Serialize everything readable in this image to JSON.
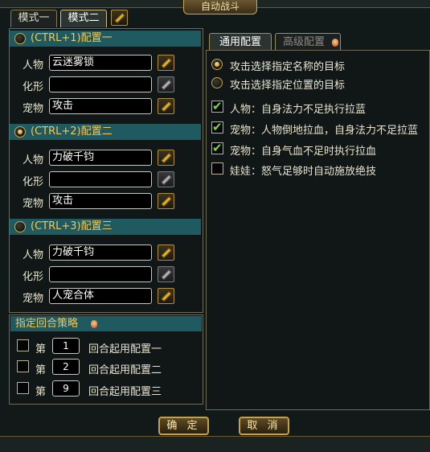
{
  "window": {
    "title": "自动战斗"
  },
  "mode_tabs": [
    {
      "label": "模式一"
    },
    {
      "label": "模式二"
    }
  ],
  "configs": [
    {
      "header": "(CTRL+1)配置一",
      "selected": false,
      "rows": [
        {
          "label": "人物",
          "value": "云迷雾锁",
          "edit_enabled": true
        },
        {
          "label": "化形",
          "value": "",
          "edit_enabled": false
        },
        {
          "label": "宠物",
          "value": "攻击",
          "edit_enabled": true
        }
      ]
    },
    {
      "header": "(CTRL+2)配置二",
      "selected": true,
      "rows": [
        {
          "label": "人物",
          "value": "力破千钧",
          "edit_enabled": true
        },
        {
          "label": "化形",
          "value": "",
          "edit_enabled": false
        },
        {
          "label": "宠物",
          "value": "攻击",
          "edit_enabled": true
        }
      ]
    },
    {
      "header": "(CTRL+3)配置三",
      "selected": false,
      "rows": [
        {
          "label": "人物",
          "value": "力破千钧",
          "edit_enabled": true
        },
        {
          "label": "化形",
          "value": "",
          "edit_enabled": false
        },
        {
          "label": "宠物",
          "value": "人宠合体",
          "edit_enabled": true
        }
      ]
    }
  ],
  "round_strategy": {
    "header": "指定回合策略",
    "rows": [
      {
        "prefix": "第",
        "round": "1",
        "suffix": "回合起用配置一",
        "checked": false
      },
      {
        "prefix": "第",
        "round": "2",
        "suffix": "回合起用配置二",
        "checked": false
      },
      {
        "prefix": "第",
        "round": "9",
        "suffix": "回合起用配置三",
        "checked": false
      }
    ]
  },
  "right_tabs": [
    {
      "label": "通用配置"
    },
    {
      "label": "高级配置"
    }
  ],
  "target_options": [
    {
      "label": "攻击选择指定名称的目标",
      "selected": true
    },
    {
      "label": "攻击选择指定位置的目标",
      "selected": false
    }
  ],
  "auto_options": [
    {
      "label": "人物：自身法力不足执行拉蓝",
      "checked": true
    },
    {
      "label": "宠物：人物倒地拉血，自身法力不足拉蓝",
      "checked": true
    },
    {
      "label": "宠物：自身气血不足时执行拉血",
      "checked": true
    },
    {
      "label": "娃娃：怒气足够时自动施放绝技",
      "checked": false
    }
  ],
  "buttons": {
    "confirm": "确 定",
    "cancel": "取 消"
  },
  "colors": {
    "header_bg": "#1f5a61",
    "header_text": "#f2c75a",
    "check_green": "#7fd83a",
    "gold_border": "#c8a048"
  }
}
